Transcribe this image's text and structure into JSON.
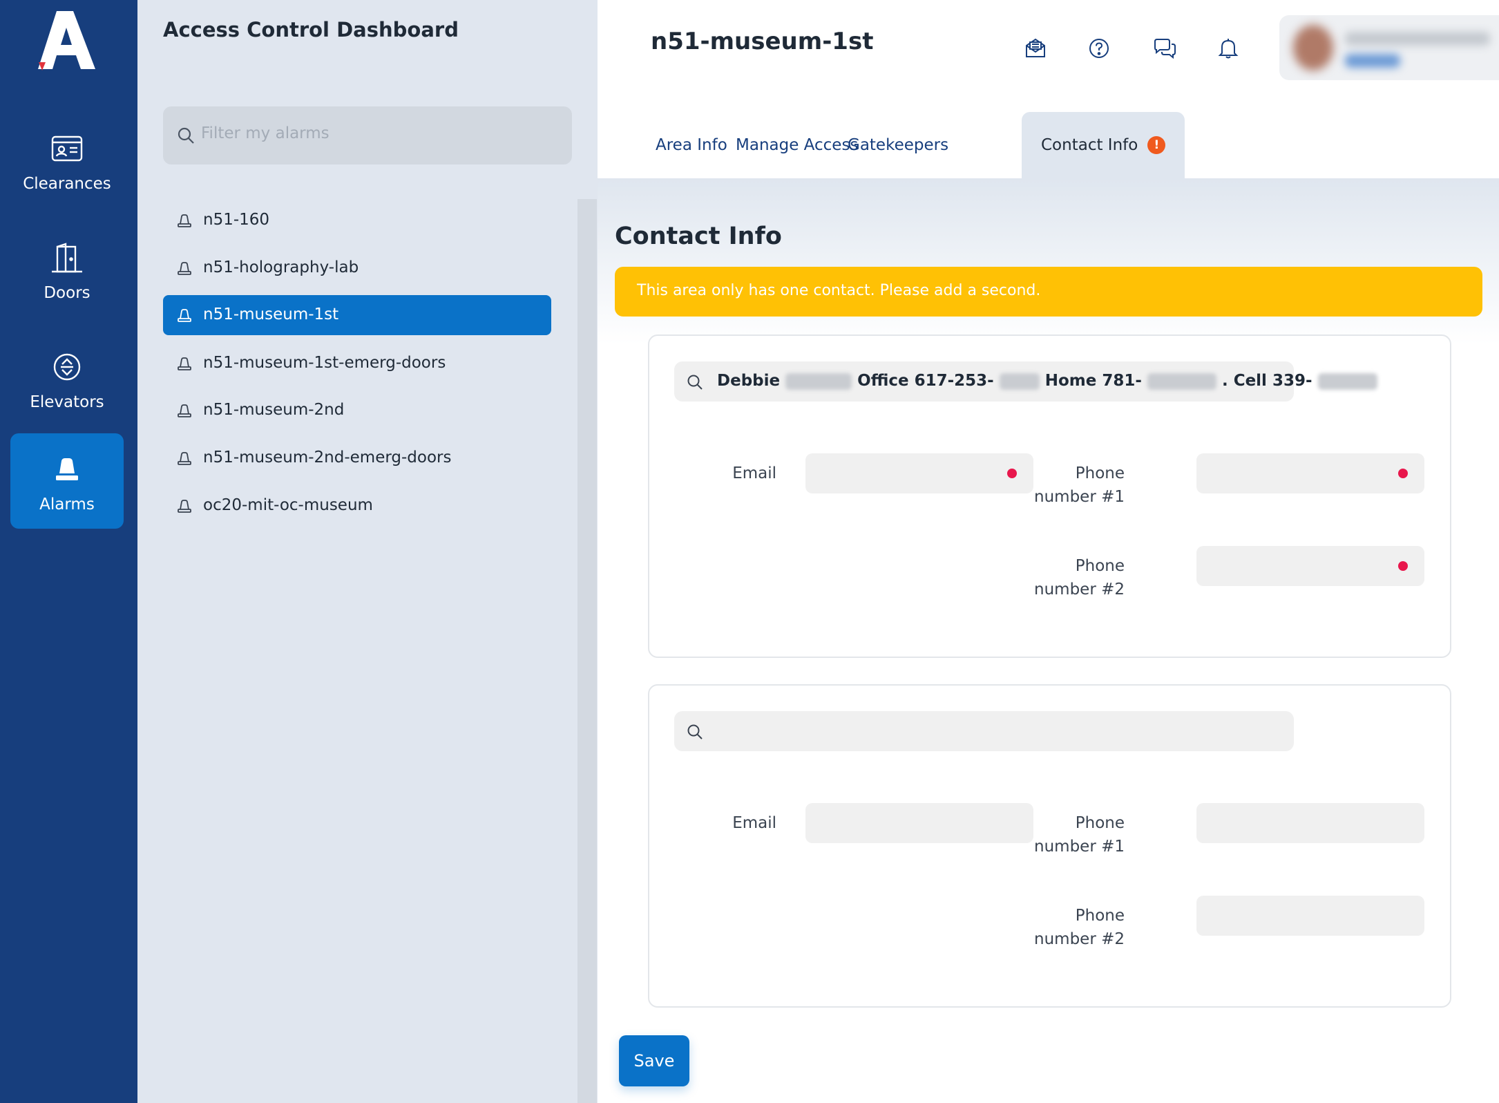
{
  "rail": {
    "items": [
      {
        "label": "Clearances",
        "icon": "id-card-icon"
      },
      {
        "label": "Doors",
        "icon": "door-icon"
      },
      {
        "label": "Elevators",
        "icon": "elevator-icon"
      },
      {
        "label": "Alarms",
        "icon": "alarm-icon",
        "active": true
      }
    ]
  },
  "panel": {
    "title": "Access Control Dashboard",
    "filter_placeholder": "Filter my alarms",
    "alarms": [
      {
        "label": "n51-160"
      },
      {
        "label": "n51-holography-lab"
      },
      {
        "label": "n51-museum-1st",
        "active": true
      },
      {
        "label": "n51-museum-1st-emerg-doors"
      },
      {
        "label": "n51-museum-2nd"
      },
      {
        "label": "n51-museum-2nd-emerg-doors"
      },
      {
        "label": "oc20-mit-oc-museum"
      }
    ]
  },
  "header": {
    "title": "n51-museum-1st",
    "icons": [
      "mail-icon",
      "help-icon",
      "chat-icon",
      "bell-icon"
    ]
  },
  "tabs": [
    {
      "label": "Area Info"
    },
    {
      "label": "Manage Access"
    },
    {
      "label": "Gatekeepers"
    },
    {
      "label": "Contact Info",
      "active": true,
      "warning": "!"
    }
  ],
  "contact": {
    "section_title": "Contact Info",
    "alert": "This area only has one contact. Please add a second.",
    "contact1": {
      "search_parts": [
        "Debbie",
        "Office 617-253-",
        "Home 781-",
        ". Cell 339-"
      ],
      "email_label": "Email",
      "phone1_label": "Phone number #1",
      "phone2_label": "Phone number #2"
    },
    "contact2": {
      "search_value": "",
      "email_label": "Email",
      "phone1_label": "Phone number #1",
      "phone2_label": "Phone number #2"
    },
    "save_label": "Save"
  },
  "colors": {
    "rail": "#173e7d",
    "accent": "#0a72c8",
    "alert": "#ffc105",
    "required": "#e8174c",
    "warning": "#f05a1e"
  }
}
